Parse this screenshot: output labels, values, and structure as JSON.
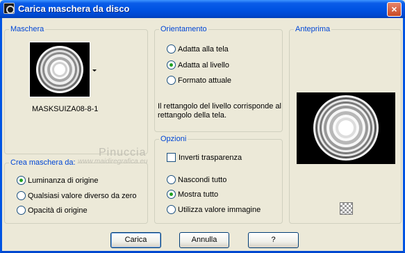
{
  "window": {
    "title": "Carica maschera da disco",
    "close_glyph": "×"
  },
  "mask": {
    "group_title": "Maschera",
    "name": "MASKSUIZA08-8-1"
  },
  "orientation": {
    "group_title": "Orientamento",
    "options": [
      "Adatta alla tela",
      "Adatta al livello",
      "Formato attuale"
    ],
    "selected": "Adatta al livello",
    "note": "Il rettangolo del livello corrisponde al rettangolo della tela."
  },
  "preview": {
    "group_title": "Anteprima"
  },
  "create_from": {
    "group_title": "Crea maschera da:",
    "options": [
      "Luminanza di origine",
      "Qualsiasi valore diverso da zero",
      "Opacità di origine"
    ],
    "selected": "Luminanza di origine"
  },
  "options": {
    "group_title": "Opzioni",
    "invert_label": "Inverti trasparenza",
    "invert_checked": false,
    "visibility_options": [
      "Nascondi tutto",
      "Mostra tutto",
      "Utilizza valore immagine"
    ],
    "selected": "Mostra tutto"
  },
  "buttons": {
    "ok": "Carica",
    "cancel": "Annulla",
    "help": "?"
  },
  "watermark": {
    "name": "Pinuccia",
    "url": "www.maidiregrafica.eu"
  },
  "icons": {
    "app": "mask-app-icon",
    "dropdown": "triangle-down-icon",
    "texture": "checker-texture-icon"
  }
}
